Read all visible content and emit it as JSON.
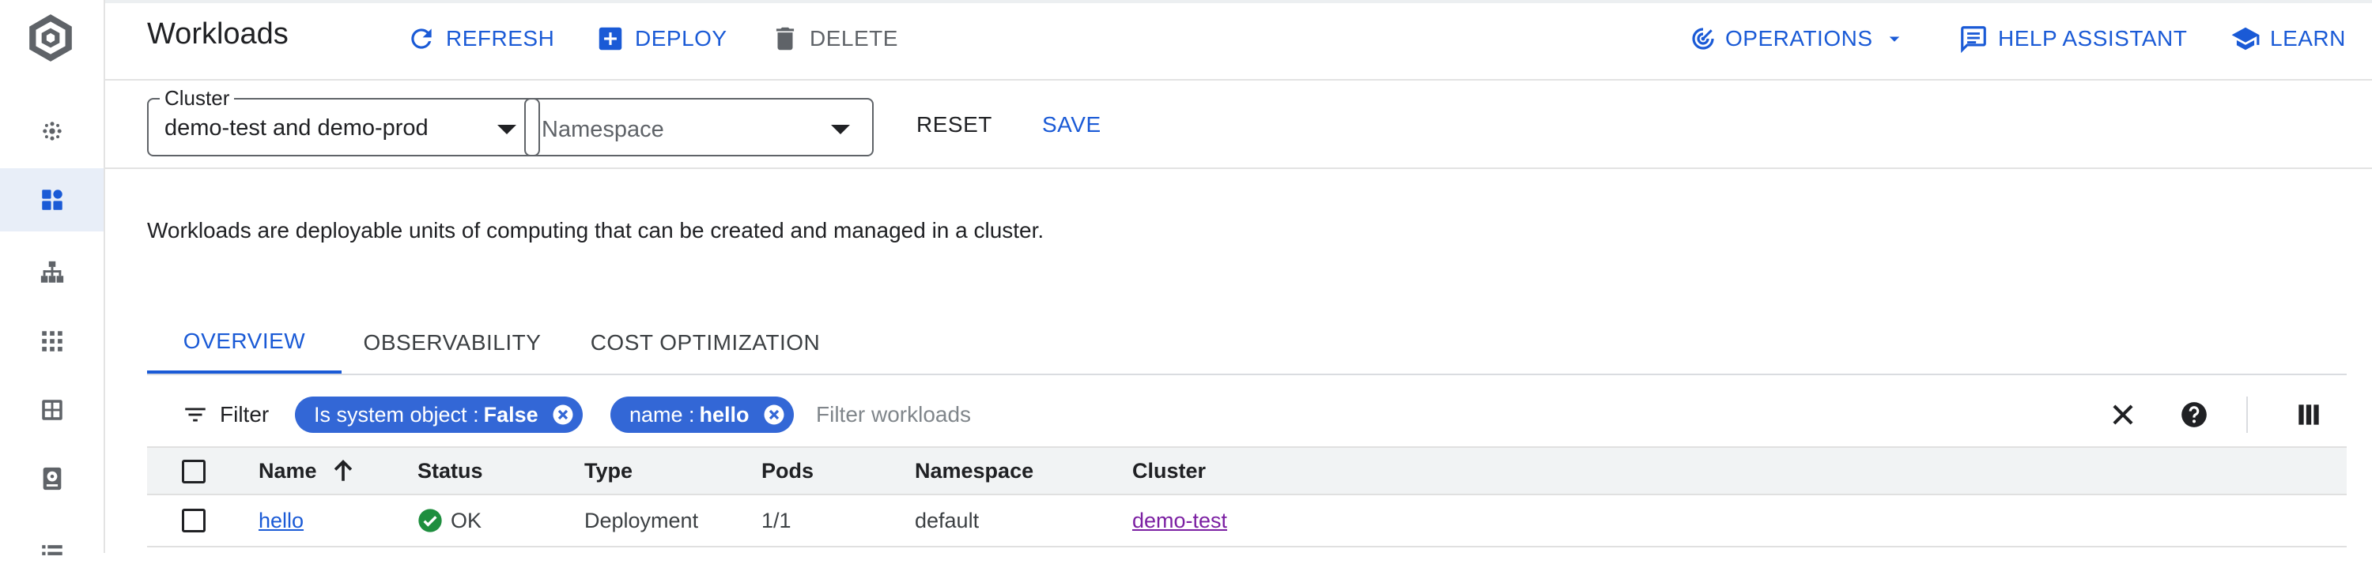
{
  "header": {
    "title": "Workloads",
    "actions": {
      "refresh": "REFRESH",
      "deploy": "DEPLOY",
      "delete": "DELETE",
      "operations": "OPERATIONS",
      "help_assistant": "HELP ASSISTANT",
      "learn": "LEARN"
    }
  },
  "filters": {
    "cluster_label": "Cluster",
    "cluster_value": "demo-test and demo-prod",
    "namespace_placeholder": "Namespace",
    "reset": "RESET",
    "save": "SAVE"
  },
  "description": "Workloads are deployable units of computing that can be created and managed in a cluster.",
  "tabs": [
    {
      "label": "OVERVIEW",
      "active": true
    },
    {
      "label": "OBSERVABILITY",
      "active": false
    },
    {
      "label": "COST OPTIMIZATION",
      "active": false
    }
  ],
  "filterbar": {
    "filter_label": "Filter",
    "chips": [
      {
        "key": "Is system object : ",
        "value": "False"
      },
      {
        "key": "name : ",
        "value": "hello"
      }
    ],
    "placeholder": "Filter workloads"
  },
  "table": {
    "columns": [
      "Name",
      "Status",
      "Type",
      "Pods",
      "Namespace",
      "Cluster"
    ],
    "sort_column": "Name",
    "sort_direction": "ascending",
    "rows": [
      {
        "name": "hello",
        "status": "OK",
        "type": "Deployment",
        "pods": "1/1",
        "namespace": "default",
        "cluster": "demo-test"
      }
    ]
  },
  "colors": {
    "accent": "#1a5ad6",
    "chip": "#3367d6",
    "ok": "#1e8e3e",
    "cluster_link": "#7b1fa2",
    "active_nav_bg": "#e8eef8"
  },
  "icons": {
    "rail": [
      "app-logo-icon",
      "dashboard-dots-icon",
      "workloads-icon",
      "network-tree-icon",
      "apps-grid-icon",
      "grid-box-icon",
      "storage-icon",
      "list-icon"
    ],
    "header": [
      "refresh-icon",
      "add-box-icon",
      "trash-icon",
      "operations-icon",
      "chat-help-icon",
      "school-icon"
    ],
    "filterbar": [
      "filter-list-icon",
      "close-icon",
      "help-circle-icon",
      "column-display-icon"
    ]
  }
}
